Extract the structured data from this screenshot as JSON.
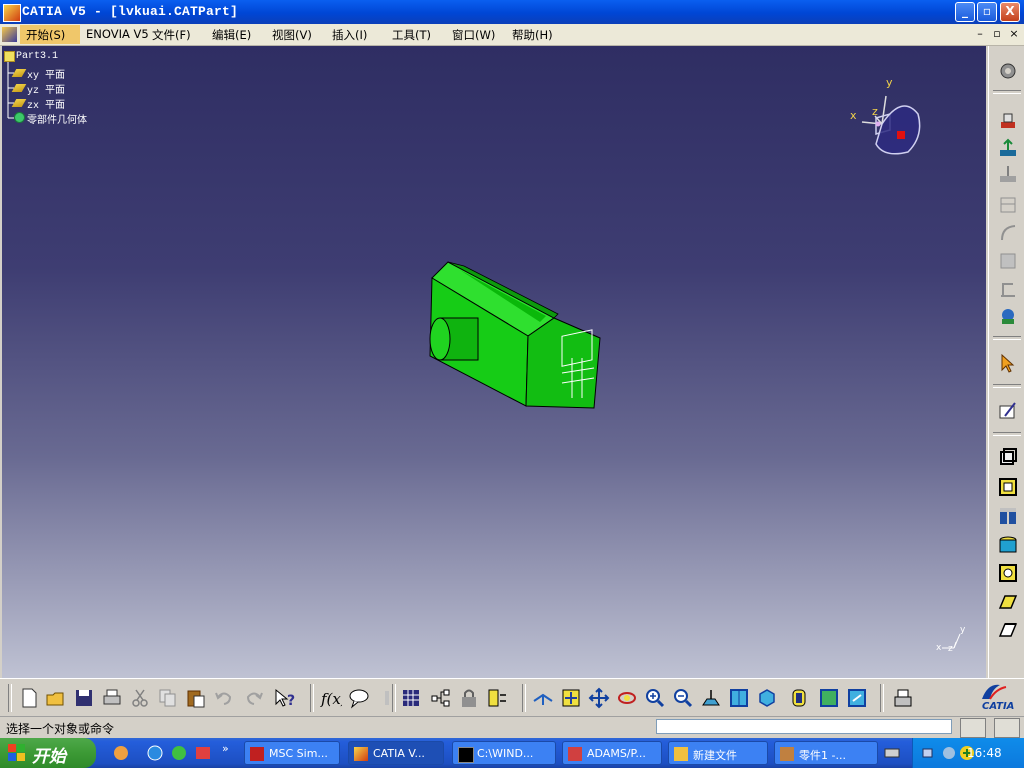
{
  "window": {
    "title": "CATIA V5 - [lvkuai.CATPart]",
    "minimize": "_",
    "maximize": "▫",
    "close": "X"
  },
  "menu": {
    "items": [
      "开始(S)",
      "ENOVIA V5",
      "文件(F)",
      "编辑(E)",
      "视图(V)",
      "插入(I)",
      "工具(T)",
      "窗口(W)",
      "帮助(H)"
    ]
  },
  "tree": {
    "root": "Part3.1",
    "nodes": [
      "xy 平面",
      "yz 平面",
      "zx 平面",
      "零部件几何体"
    ]
  },
  "compass": {
    "x": "x",
    "y": "y",
    "z": "z"
  },
  "axis_triad": {
    "x": "x",
    "y": "y",
    "z": "z"
  },
  "status": {
    "prompt": "选择一个对象或命令",
    "command_value": ""
  },
  "brand": {
    "logo_text": "CATIA"
  },
  "taskbar": {
    "start": "开始",
    "tasks": [
      {
        "label": "MSC Sim..."
      },
      {
        "label": "CATIA V..."
      },
      {
        "label": "C:\\WIND..."
      },
      {
        "label": "ADAMS/P..."
      },
      {
        "label": "新建文件"
      },
      {
        "label": "零件1 -..."
      }
    ],
    "clock": "16:48"
  },
  "colors": {
    "part_green": "#16cc16",
    "viewport_top": "#2f2e63",
    "viewport_bottom": "#bfc2d3",
    "title_blue": "#0a5ff0",
    "taskbar_blue": "#245edb",
    "start_green": "#3c9a35"
  },
  "icons": {
    "right_toolbar": [
      "gear-icon",
      "sketcher-icon",
      "pad-icon",
      "pocket-icon",
      "shaft-icon",
      "groove-icon",
      "hole-icon",
      "rib-icon",
      "slot-icon",
      "stiffener-icon",
      "select-icon",
      "sketch-pencil-icon",
      "edge-fillet-icon",
      "chamfer-icon",
      "draft-icon",
      "shell-icon",
      "thickness-icon",
      "thread-icon",
      "remove-face-icon"
    ],
    "bottom_toolbar": [
      "new-icon",
      "open-icon",
      "save-icon",
      "print-icon",
      "cut-icon",
      "copy-icon",
      "paste-icon",
      "undo-icon",
      "redo-icon",
      "help-icon",
      "formula-icon",
      "comment-icon",
      "measure-icon",
      "table-icon",
      "tree-icon",
      "lock-icon",
      "parameter-icon",
      "fly-icon",
      "fit-all-icon",
      "pan-icon",
      "rotate-icon",
      "zoom-in-icon",
      "zoom-out-icon",
      "normal-view-icon",
      "iso-view-icon",
      "cube-view-icon",
      "hide-show-icon",
      "shading-icon",
      "swap-icon",
      "apply-icon"
    ]
  }
}
